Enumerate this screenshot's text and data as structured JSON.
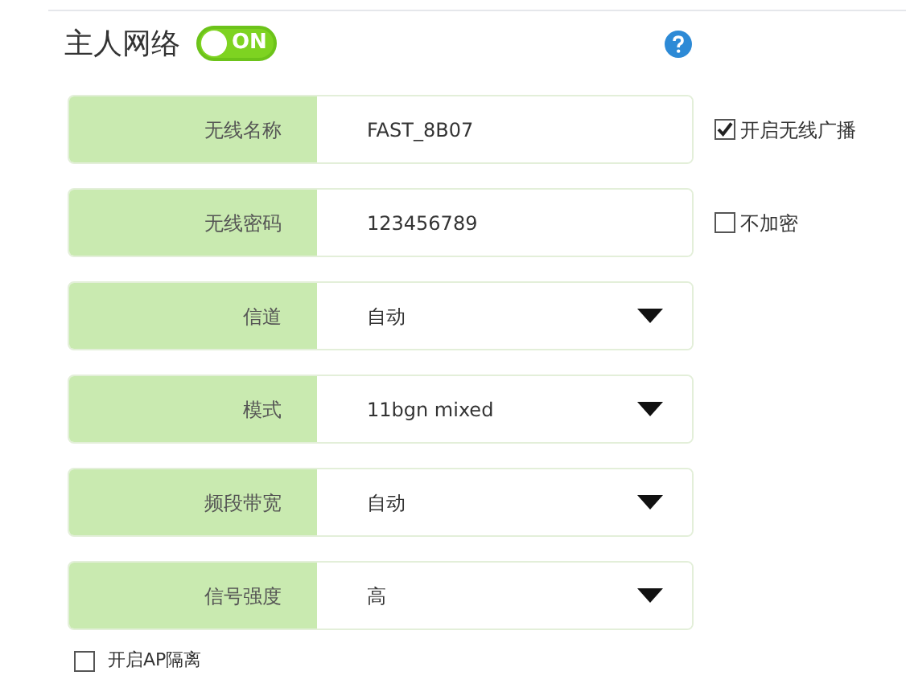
{
  "section": {
    "title": "主人网络",
    "toggle": {
      "label": "ON",
      "on": true
    }
  },
  "fields": [
    {
      "kind": "text",
      "label": "无线名称",
      "value": "FAST_8B07",
      "option": {
        "label": "开启无线广播",
        "checked": true
      }
    },
    {
      "kind": "text",
      "label": "无线密码",
      "value": "123456789",
      "option": {
        "label": "不加密",
        "checked": false
      }
    },
    {
      "kind": "select",
      "label": "信道",
      "value": "自动"
    },
    {
      "kind": "select",
      "label": "模式",
      "value": "11bgn mixed"
    },
    {
      "kind": "select",
      "label": "频段带宽",
      "value": "自动"
    },
    {
      "kind": "select",
      "label": "信号强度",
      "value": "高"
    }
  ],
  "ap_isolation": {
    "label": "开启AP隔离",
    "checked": false
  }
}
